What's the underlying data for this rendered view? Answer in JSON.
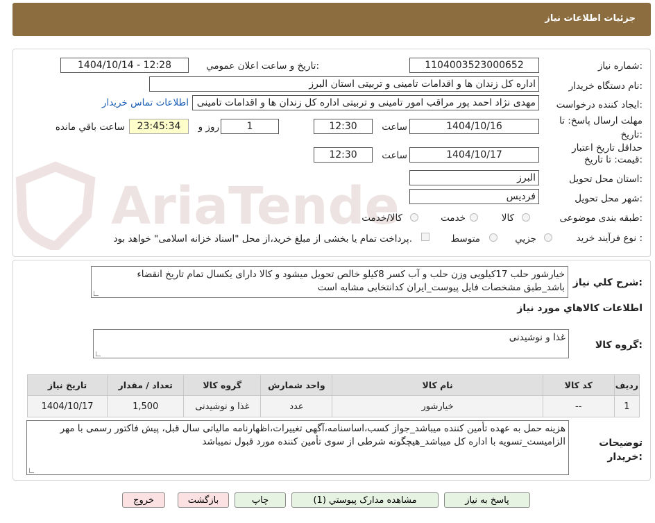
{
  "header": {
    "title": "جزئیات اطلاعات نیاز"
  },
  "watermark": {
    "text": "AriaTender.neT"
  },
  "form": {
    "need_number": {
      "label": "شماره نیاز:",
      "value": "1104003523000652"
    },
    "announce_datetime": {
      "label": "تاریخ و ساعت اعلان عمومي:",
      "value": "1404/10/14 - 12:28"
    },
    "buyer_org": {
      "label": "نام دستگاه خريدار:",
      "value": "اداره کل زندان ها و اقدامات تامینی و تربیتی استان البرز"
    },
    "requester": {
      "label": "ايجاد کننده درخواست:",
      "value": "مهدی نژاد احمد پور مراقب امور تامینی و تربیتی اداره کل زندان ها و اقدامات تامینی",
      "contact_link": "اطلاعات تماس خريدار"
    },
    "deadline": {
      "label": "مهلت ارسال پاسخ: تا تاريخ:",
      "date": "1404/10/16",
      "time_label": "ساعت",
      "time": "12:30",
      "days": "1",
      "days_label": "روز و",
      "remaining": "23:45:34",
      "remaining_label": "ساعت باقي مانده"
    },
    "validity": {
      "label": "حداقل تاريخ اعتبار قيمت: تا تاريخ:",
      "date": "1404/10/17",
      "time_label": "ساعت",
      "time": "12:30"
    },
    "province": {
      "label": "استان محل تحويل:",
      "value": "البرز"
    },
    "city": {
      "label": "شهر محل تحويل:",
      "value": "فرديس"
    },
    "category": {
      "label": "طبقه بندی موضوعی:",
      "options": [
        "کالا",
        "خدمت",
        "کالا/خدمت"
      ]
    },
    "process_type": {
      "label": "نوع فرآيند خريد :",
      "options": [
        "جزیي",
        "متوسط"
      ],
      "note": "پرداخت تمام يا بخشی از مبلغ خريد،از محل \"اسناد خزانه اسلامی\" خواهد بود."
    }
  },
  "summary": {
    "label": "شرح کلي نياز:",
    "value": "خیارشور حلب 17کیلویی وزن حلب و آب کسر 8کیلو خالص تحویل میشود و کالا دارای یکسال تمام تاریخ انقضاء باشد_طبق مشخصات فایل پیوست_ایران کدانتخابی مشابه است"
  },
  "items_section": {
    "title": "اطلاعات کالاهاي مورد نياز"
  },
  "goods_group": {
    "label": "گروه کالا:",
    "value": "غذا و نوشیدنی"
  },
  "table": {
    "headers": [
      "رديف",
      "کد کالا",
      "نام کالا",
      "واحد شمارش",
      "گروه کالا",
      "تعداد / مقدار",
      "تاريخ نياز"
    ],
    "rows": [
      [
        "1",
        "--",
        "خیارشور",
        "عدد",
        "غذا و نوشیدنی",
        "1,500",
        "1404/10/17"
      ]
    ]
  },
  "buyer_notes": {
    "label": "توضيحات خريدار:",
    "value": "هزینه حمل به عهده تأمین کننده میباشد_جواز کسب،اساسنامه،آگهی تغییرات،اظهارنامه مالیاتی سال قبل، پیش فاکتور رسمی با مهر الزامیست_تسویه با اداره کل میباشد_هیچگونه شرطی از سوی تأمین کننده مورد قبول نمیباشد"
  },
  "buttons": {
    "reply": "پاسخ به نياز",
    "attachments": "مشاهده مدارک پيوستي (1)",
    "print": "چاپ",
    "back": "بازگشت",
    "exit": "خروج"
  }
}
